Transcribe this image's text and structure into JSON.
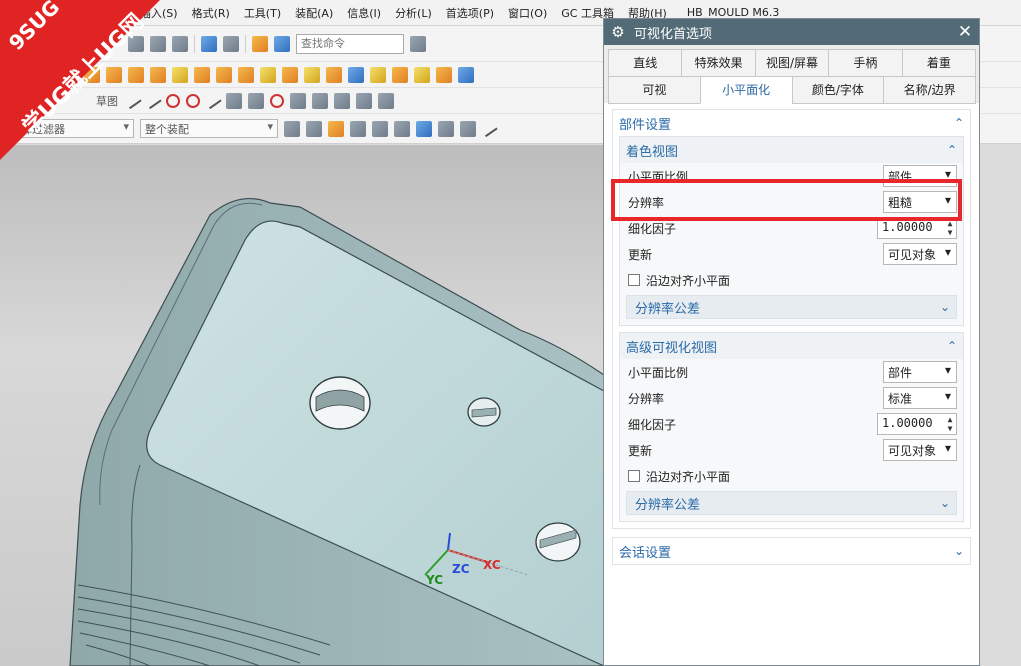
{
  "app": {
    "menu": [
      "插入(S)",
      "格式(R)",
      "工具(T)",
      "装配(A)",
      "信息(I)",
      "分析(L)",
      "首选项(P)",
      "窗口(O)",
      "GC 工具箱",
      "帮助(H)"
    ],
    "window_title": "HB_MOULD M6.3",
    "search_placeholder": "查找命令",
    "filters": [
      "择过滤器",
      "整个装配"
    ],
    "sketch_partial": "草图"
  },
  "watermark": {
    "line1": "9SUG",
    "line2": "学UG就上UG网"
  },
  "viewport": {
    "axes": {
      "x": "XC",
      "y": "YC",
      "z": "ZC"
    }
  },
  "dialog": {
    "title": "可视化首选项",
    "tabs_row1": [
      "直线",
      "特殊效果",
      "视图/屏幕",
      "手柄",
      "着重"
    ],
    "tabs_row2": [
      "可视",
      "小平面化",
      "颜色/字体",
      "名称/边界"
    ],
    "active_tab": "小平面化",
    "part_settings": {
      "title": "部件设置",
      "shaded": {
        "title": "着色视图",
        "facet_ratio_label": "小平面比例",
        "facet_ratio_value": "部件",
        "resolution_label": "分辨率",
        "resolution_value": "粗糙",
        "refine_label": "细化因子",
        "refine_value": "1.00000",
        "update_label": "更新",
        "update_value": "可见对象",
        "align_label": "沿边对齐小平面",
        "tolerance_title": "分辨率公差"
      },
      "advanced": {
        "title": "高级可视化视图",
        "facet_ratio_label": "小平面比例",
        "facet_ratio_value": "部件",
        "resolution_label": "分辨率",
        "resolution_value": "标准",
        "refine_label": "细化因子",
        "refine_value": "1.00000",
        "update_label": "更新",
        "update_value": "可见对象",
        "align_label": "沿边对齐小平面",
        "tolerance_title": "分辨率公差"
      }
    },
    "session_settings": {
      "title": "会话设置"
    }
  }
}
